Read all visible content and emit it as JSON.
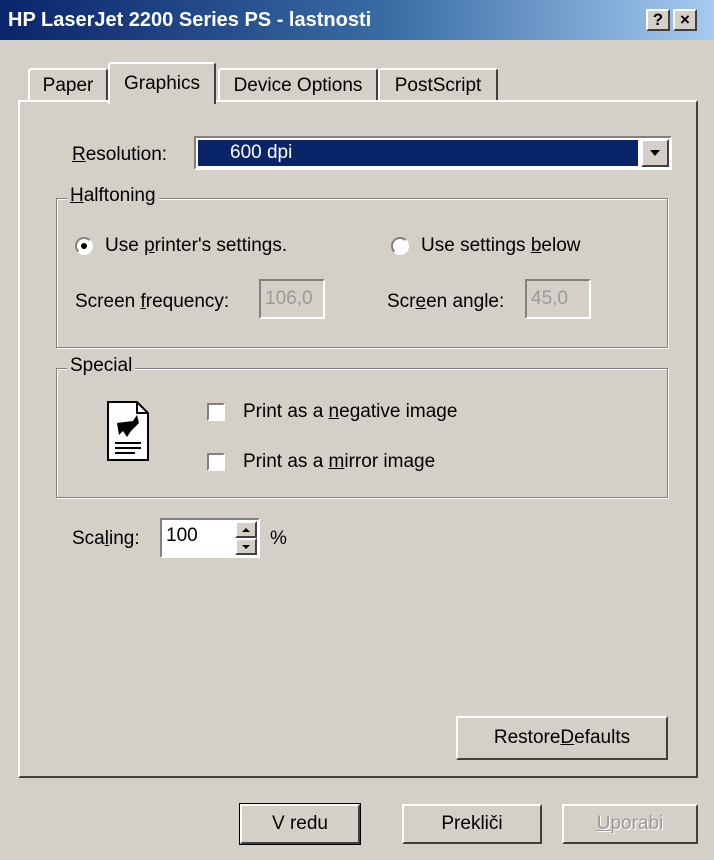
{
  "window": {
    "title": "HP LaserJet 2200 Series PS - lastnosti",
    "help_label": "?",
    "close_label": "×"
  },
  "tabs": [
    {
      "label": "Paper"
    },
    {
      "label": "Graphics"
    },
    {
      "label": "Device Options"
    },
    {
      "label": "PostScript"
    }
  ],
  "resolution": {
    "label_u": "R",
    "label_rest": "esolution:",
    "value": "600 dpi"
  },
  "halftoning": {
    "title_u": "H",
    "title_rest": "alftoning",
    "option_printer_pre": "Use ",
    "option_printer_u": "p",
    "option_printer_post": "rinter's settings.",
    "option_below_pre": "Use settings ",
    "option_below_u": "b",
    "option_below_post": "elow",
    "freq_label_pre": "Screen ",
    "freq_label_u": "f",
    "freq_label_post": "requency:",
    "freq_value": "106,0",
    "angle_label_pre": "Scr",
    "angle_label_u": "e",
    "angle_label_post": "en angle:",
    "angle_value": "45,0"
  },
  "special": {
    "title": "Special",
    "negative_pre": "Print as a ",
    "negative_u": "n",
    "negative_post": "egative image",
    "mirror_pre": "Print as a ",
    "mirror_u": "m",
    "mirror_post": "irror image"
  },
  "scaling": {
    "label_pre": "Sca",
    "label_u": "l",
    "label_post": "ing:",
    "value": "100",
    "unit": "%"
  },
  "restore_defaults": {
    "pre": "Restore ",
    "u": "D",
    "post": "efaults"
  },
  "footer": {
    "ok": "V redu",
    "cancel": "Prekliči",
    "apply_u": "U",
    "apply_rest": "porabi"
  }
}
